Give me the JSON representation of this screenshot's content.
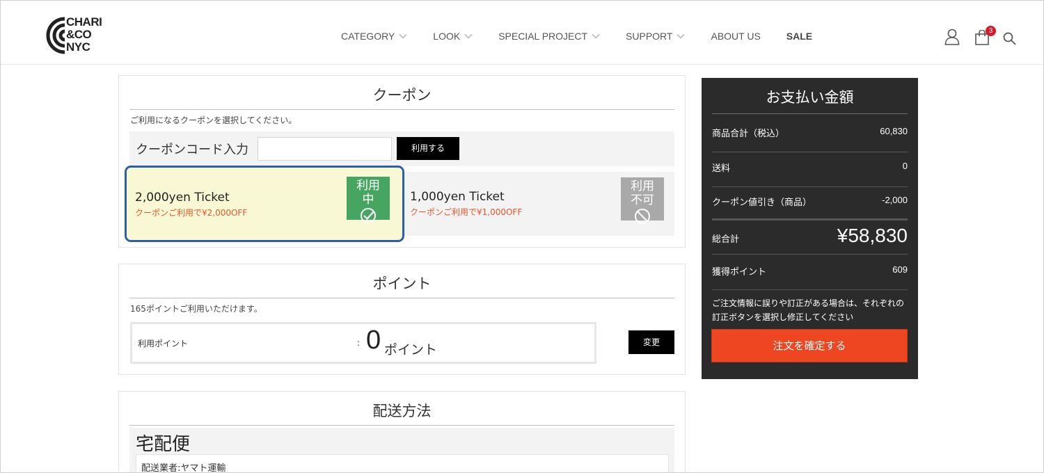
{
  "brand": {
    "logo_line1": "CHARI",
    "logo_line2": "&CO",
    "logo_line3": "NYC"
  },
  "nav": {
    "category": "CATEGORY",
    "look": "LOOK",
    "special_project": "SPECIAL PROJECT",
    "support": "SUPPORT",
    "about_us": "ABOUT US",
    "sale": "SALE"
  },
  "header_icons": {
    "account": "user-icon",
    "cart": "shopping-bag-icon",
    "search": "search-icon",
    "cart_count": "3"
  },
  "coupon": {
    "title": "クーポン",
    "note": "ご利用になるクーポンを選択してください。",
    "code_label": "クーポンコード入力",
    "code_value": "",
    "apply_label": "利用する",
    "tickets": [
      {
        "name": "2,000yen Ticket",
        "desc": "クーポンご利用で¥2,000OFF",
        "badge_line1": "利用",
        "badge_line2": "中",
        "status": "in-use"
      },
      {
        "name": "1,000yen Ticket",
        "desc": "クーポンご利用で¥1,000OFF",
        "badge_line1": "利用",
        "badge_line2": "不可",
        "status": "unavailable"
      }
    ]
  },
  "points": {
    "title": "ポイント",
    "note": "165ポイントご利用いただけます。",
    "label": "利用ポイント",
    "colon": ":",
    "value": "0",
    "unit": "ポイント",
    "change_label": "変更"
  },
  "shipping": {
    "title": "配送方法",
    "method": "宅配便",
    "carrier": "配送業者:ヤマト運輸"
  },
  "summary": {
    "title": "お支払い金額",
    "subtotal_label": "商品合計（税込）",
    "subtotal_value": "60,830",
    "shipping_label": "送料",
    "shipping_value": "0",
    "coupon_label": "クーポン値引き（商品）",
    "coupon_value": "-2,000",
    "total_label": "総合計",
    "total_value": "¥58,830",
    "points_label": "獲得ポイント",
    "points_value": "609",
    "note": "ご注文情報に誤りや訂正がある場合は、それぞれの訂正ボタンを選択し修正してください",
    "confirm_label": "注文を確定する"
  },
  "colors": {
    "accent": "#ee4620",
    "in_use": "#45a561",
    "unavailable": "#a9a9a9",
    "selected_border": "#2c5fa8",
    "summary_bg": "#2b2b2b"
  }
}
